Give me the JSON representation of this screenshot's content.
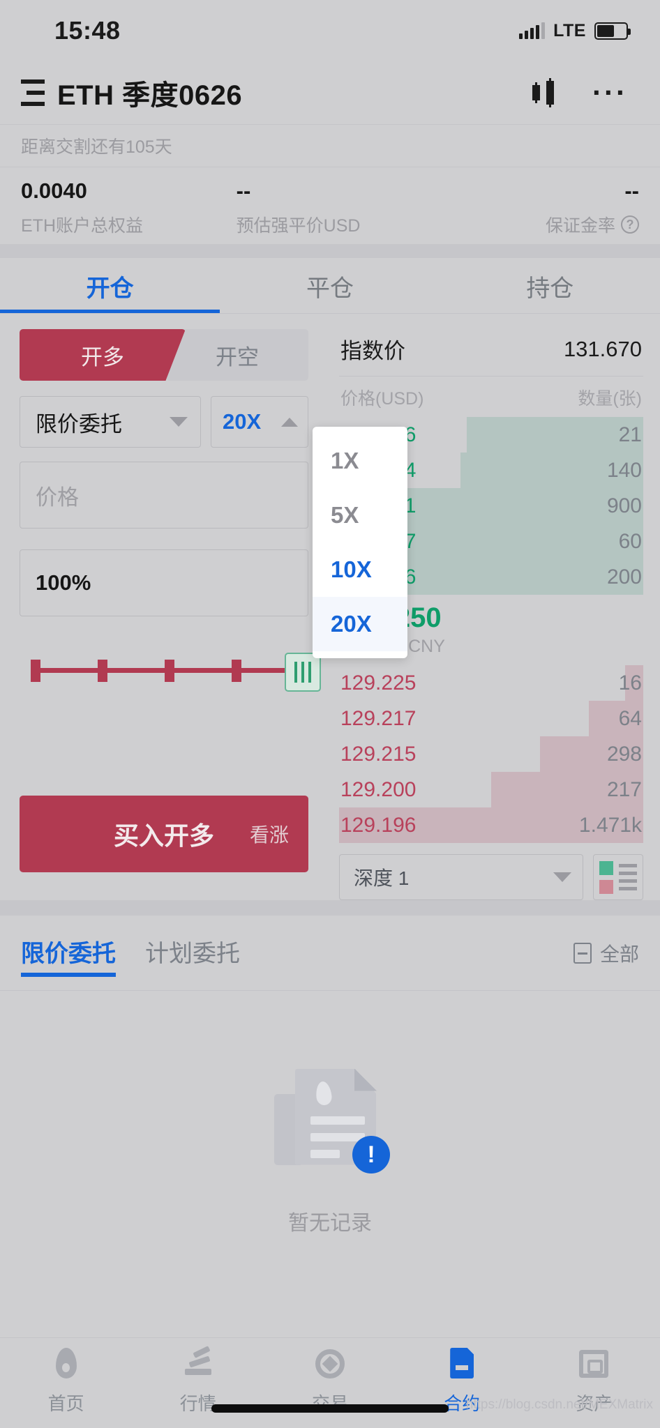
{
  "status": {
    "time": "15:48",
    "network": "LTE"
  },
  "header": {
    "pair": "ETH 季度0626",
    "kline_icon": "candlestick-icon",
    "more_icon": "more-options-icon"
  },
  "delivery_notice": "距离交割还有105天",
  "summary": {
    "equity_value": "0.0040",
    "equity_label": "ETH账户总权益",
    "liq_value": "--",
    "liq_label": "预估强平价USD",
    "margin_value": "--",
    "margin_label": "保证金率",
    "help_icon": "question-mark-icon"
  },
  "main_tabs": [
    {
      "label": "开仓",
      "active": true
    },
    {
      "label": "平仓",
      "active": false
    },
    {
      "label": "持仓",
      "active": false
    }
  ],
  "trade_form": {
    "long_label": "开多",
    "short_label": "开空",
    "order_type": "限价委托",
    "leverage": "20X",
    "price_placeholder": "价格",
    "amount_value": "100%",
    "submit_label": "买入开多",
    "submit_sub": "看涨"
  },
  "leverage_dropdown": {
    "open": true,
    "options": [
      {
        "label": "1X",
        "state": "normal"
      },
      {
        "label": "5X",
        "state": "normal"
      },
      {
        "label": "10X",
        "state": "highlight"
      },
      {
        "label": "20X",
        "state": "current"
      }
    ]
  },
  "orderbook": {
    "index_label": "指数价",
    "index_value": "131.670",
    "col_price": "价格(USD)",
    "col_qty": "数量(张)",
    "asks": [
      {
        "price": "129.266",
        "qty": "21",
        "depth": 58
      },
      {
        "price": "129.264",
        "qty": "140",
        "depth": 60
      },
      {
        "price": "129.251",
        "qty": "900",
        "depth": 78
      },
      {
        "price": "129.247",
        "qty": "60",
        "depth": 80
      },
      {
        "price": "129.226",
        "qty": "200",
        "depth": 86
      }
    ],
    "last_price": "129.250",
    "last_price_cny": "≈953.86 CNY",
    "bids": [
      {
        "price": "129.225",
        "qty": "16",
        "depth": 6
      },
      {
        "price": "129.217",
        "qty": "64",
        "depth": 18
      },
      {
        "price": "129.215",
        "qty": "298",
        "depth": 34
      },
      {
        "price": "129.200",
        "qty": "217",
        "depth": 50
      },
      {
        "price": "129.196",
        "qty": "1.471k",
        "depth": 100
      }
    ],
    "depth_select": "深度 1",
    "depth_toggle_icon": "orderbook-layout-icon"
  },
  "orders_section": {
    "tabs": [
      {
        "label": "限价委托",
        "active": true
      },
      {
        "label": "计划委托",
        "active": false
      }
    ],
    "filter_label": "全部",
    "filter_icon": "filter-icon",
    "empty_text": "暂无记录",
    "empty_icon": "no-records-icon"
  },
  "bottom_nav": [
    {
      "label": "首页",
      "icon": "home-flame-icon",
      "active": false
    },
    {
      "label": "行情",
      "icon": "market-chart-icon",
      "active": false
    },
    {
      "label": "交易",
      "icon": "trade-swap-icon",
      "active": false
    },
    {
      "label": "合约",
      "icon": "contract-icon",
      "active": true
    },
    {
      "label": "资产",
      "icon": "assets-wallet-icon",
      "active": false
    }
  ],
  "watermark": "https://blog.csdn.net/MEXMatrix",
  "colors": {
    "accent_blue": "#1565d8",
    "long_red": "#b13a51",
    "ask_green": "#0f9d69",
    "bid_red": "#b8415b",
    "bg": "#cfcfd1"
  }
}
